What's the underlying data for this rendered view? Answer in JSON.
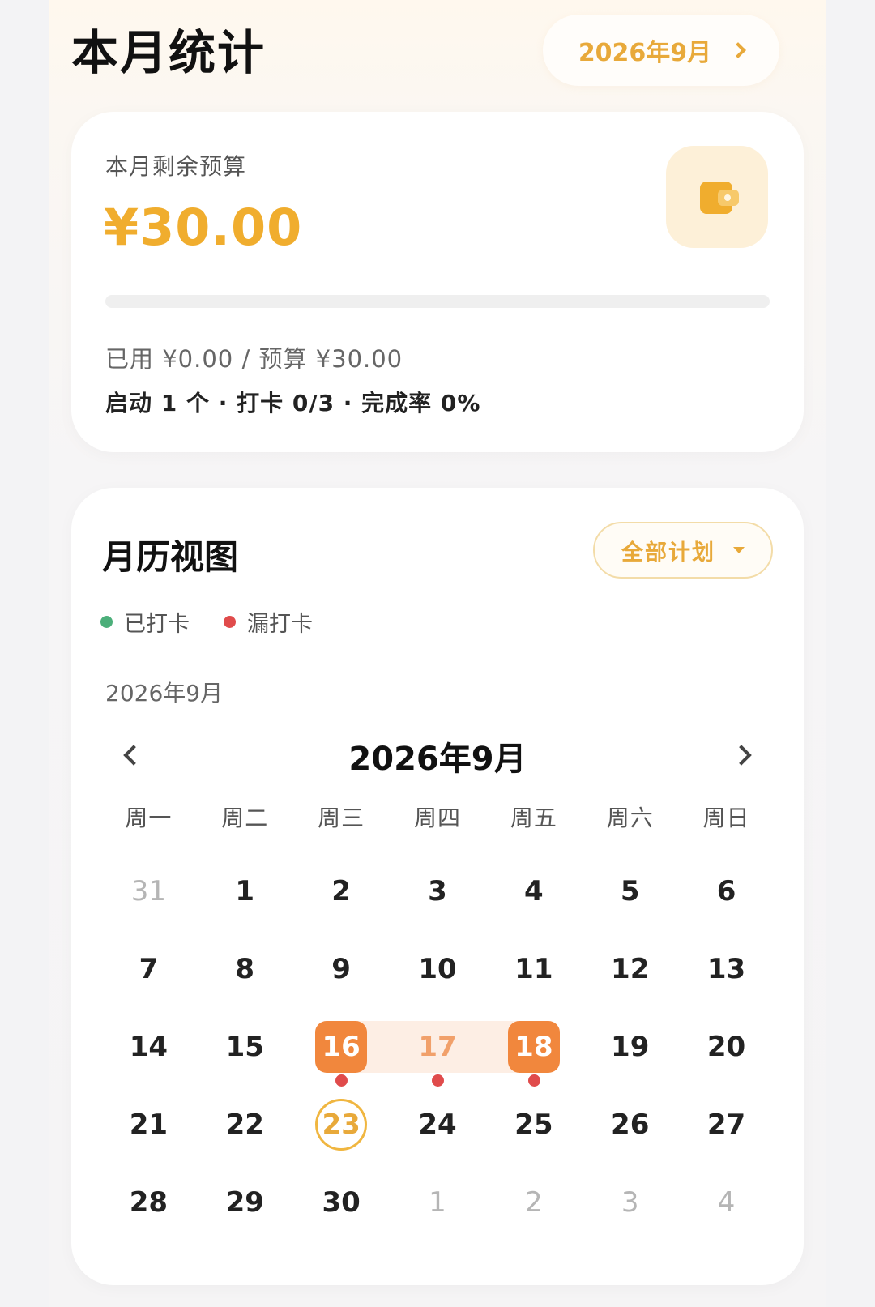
{
  "header": {
    "title": "本月统计",
    "month_label": "2026年9月"
  },
  "budget": {
    "label": "本月剩余预算",
    "amount": "¥30.00",
    "used_fraction": 0,
    "used_line": "已用 ¥0.00 / 预算 ¥30.00",
    "stats_line": "启动 1 个 · 打卡 0/3 · 完成率 0%",
    "accent": "#f0ad2e"
  },
  "calendar": {
    "title": "月历视图",
    "plan_filter": "全部计划",
    "legend": [
      {
        "label": "已打卡",
        "color": "#4caf7a"
      },
      {
        "label": "漏打卡",
        "color": "#e04b4b"
      }
    ],
    "month_caption": "2026年9月",
    "month_title": "2026年9月",
    "weekdays": [
      "周一",
      "周二",
      "周三",
      "周四",
      "周五",
      "周六",
      "周日"
    ],
    "days": [
      {
        "n": "31",
        "other": true
      },
      {
        "n": "1"
      },
      {
        "n": "2"
      },
      {
        "n": "3"
      },
      {
        "n": "4"
      },
      {
        "n": "5"
      },
      {
        "n": "6"
      },
      {
        "n": "7"
      },
      {
        "n": "8"
      },
      {
        "n": "9"
      },
      {
        "n": "10"
      },
      {
        "n": "11"
      },
      {
        "n": "12"
      },
      {
        "n": "13"
      },
      {
        "n": "14"
      },
      {
        "n": "15"
      },
      {
        "n": "16",
        "range": "start",
        "missed": true
      },
      {
        "n": "17",
        "range": "mid",
        "missed": true
      },
      {
        "n": "18",
        "range": "end",
        "missed": true
      },
      {
        "n": "19"
      },
      {
        "n": "20"
      },
      {
        "n": "21"
      },
      {
        "n": "22"
      },
      {
        "n": "23",
        "today": true
      },
      {
        "n": "24"
      },
      {
        "n": "25"
      },
      {
        "n": "26"
      },
      {
        "n": "27"
      },
      {
        "n": "28"
      },
      {
        "n": "29"
      },
      {
        "n": "30"
      },
      {
        "n": "1",
        "other": true
      },
      {
        "n": "2",
        "other": true
      },
      {
        "n": "3",
        "other": true
      },
      {
        "n": "4",
        "other": true
      }
    ],
    "accent": "#f1873d"
  }
}
